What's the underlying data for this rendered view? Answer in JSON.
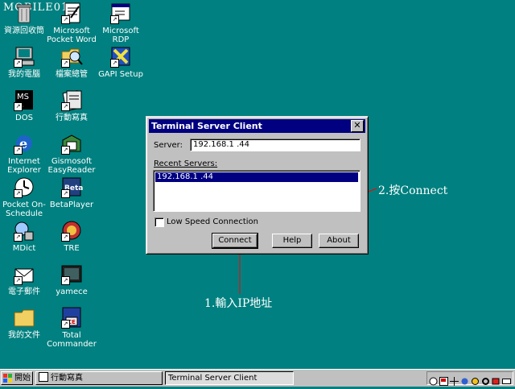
{
  "watermark": "MOBILE01",
  "desktop": {
    "icons": [
      {
        "label": "資源回收筒",
        "icon": "recycle-bin-icon"
      },
      {
        "label": "Microsoft Pocket Word",
        "icon": "pocket-word-icon"
      },
      {
        "label": "Microsoft RDP",
        "icon": "rdp-icon"
      },
      {
        "label": "我的電腦",
        "icon": "my-computer-icon"
      },
      {
        "label": "檔案總管",
        "icon": "file-explorer-icon"
      },
      {
        "label": "GAPI Setup",
        "icon": "gapi-setup-icon"
      },
      {
        "label": "DOS",
        "icon": "dos-icon"
      },
      {
        "label": "行動寫真",
        "icon": "mobile-photo-icon"
      },
      {
        "label": "Internet Explorer",
        "icon": "internet-explorer-icon"
      },
      {
        "label": "Gismosoft EasyReader",
        "icon": "easyreader-icon"
      },
      {
        "label": "Pocket On-Schedule",
        "icon": "pocket-on-schedule-icon"
      },
      {
        "label": "BetaPlayer",
        "icon": "betaplayer-icon"
      },
      {
        "label": "MDict",
        "icon": "mdict-icon"
      },
      {
        "label": "TRE",
        "icon": "tre-icon"
      },
      {
        "label": "電子郵件",
        "icon": "email-icon"
      },
      {
        "label": "yamece",
        "icon": "yamece-icon"
      },
      {
        "label": "我的文件",
        "icon": "my-documents-icon"
      },
      {
        "label": "Total Commander",
        "icon": "total-commander-icon"
      }
    ]
  },
  "dialog": {
    "title": "Terminal Server Client",
    "server_label": "Server:",
    "server_value": "192.168.1    .44",
    "recent_label": "Recent Servers:",
    "recent_items": [
      "192.168.1    .44"
    ],
    "low_speed_label": "Low Speed Connection",
    "low_speed_checked": false,
    "connect_label": "Connect",
    "help_label": "Help",
    "about_label": "About"
  },
  "annotations": {
    "step1": "1.輸入IP地址",
    "step2": "2.按Connect",
    "color": "#ff0000"
  },
  "taskbar": {
    "start_label": "開始",
    "tasks": [
      "行動寫真",
      "Terminal Server Client"
    ],
    "active_task": "Terminal Server Client"
  }
}
